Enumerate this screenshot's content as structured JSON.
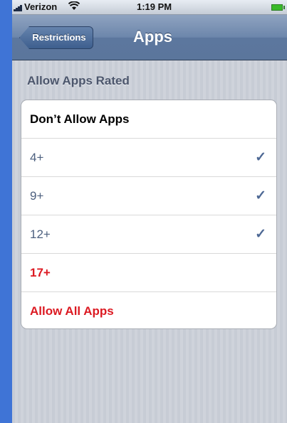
{
  "status_bar": {
    "carrier": "Verizon",
    "time": "1:19 PM",
    "wifi_icon": "wifi-icon",
    "battery_icon": "battery-icon"
  },
  "nav_bar": {
    "back_label": "Restrictions",
    "title": "Apps"
  },
  "section": {
    "header": "Allow Apps Rated",
    "rows": [
      {
        "label": "Don’t Allow Apps",
        "checked": false,
        "style": "first"
      },
      {
        "label": "4+",
        "checked": true,
        "style": "normal"
      },
      {
        "label": "9+",
        "checked": true,
        "style": "normal"
      },
      {
        "label": "12+",
        "checked": true,
        "style": "normal"
      },
      {
        "label": "17+",
        "checked": false,
        "style": "red"
      },
      {
        "label": "Allow All Apps",
        "checked": false,
        "style": "red"
      }
    ]
  },
  "colors": {
    "restricted_red": "#dc1a22",
    "rating_blue": "#4d607f",
    "check_blue": "#4d6894"
  }
}
